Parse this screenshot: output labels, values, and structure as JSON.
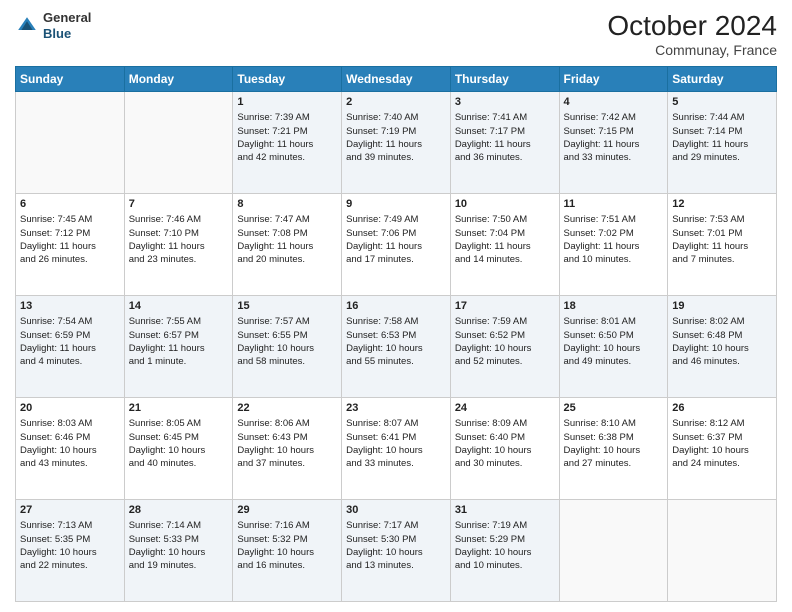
{
  "header": {
    "logo_line1": "General",
    "logo_line2": "Blue",
    "title": "October 2024",
    "subtitle": "Communay, France"
  },
  "days_of_week": [
    "Sunday",
    "Monday",
    "Tuesday",
    "Wednesday",
    "Thursday",
    "Friday",
    "Saturday"
  ],
  "weeks": [
    [
      {
        "day": "",
        "lines": []
      },
      {
        "day": "",
        "lines": []
      },
      {
        "day": "1",
        "lines": [
          "Sunrise: 7:39 AM",
          "Sunset: 7:21 PM",
          "Daylight: 11 hours",
          "and 42 minutes."
        ]
      },
      {
        "day": "2",
        "lines": [
          "Sunrise: 7:40 AM",
          "Sunset: 7:19 PM",
          "Daylight: 11 hours",
          "and 39 minutes."
        ]
      },
      {
        "day": "3",
        "lines": [
          "Sunrise: 7:41 AM",
          "Sunset: 7:17 PM",
          "Daylight: 11 hours",
          "and 36 minutes."
        ]
      },
      {
        "day": "4",
        "lines": [
          "Sunrise: 7:42 AM",
          "Sunset: 7:15 PM",
          "Daylight: 11 hours",
          "and 33 minutes."
        ]
      },
      {
        "day": "5",
        "lines": [
          "Sunrise: 7:44 AM",
          "Sunset: 7:14 PM",
          "Daylight: 11 hours",
          "and 29 minutes."
        ]
      }
    ],
    [
      {
        "day": "6",
        "lines": [
          "Sunrise: 7:45 AM",
          "Sunset: 7:12 PM",
          "Daylight: 11 hours",
          "and 26 minutes."
        ]
      },
      {
        "day": "7",
        "lines": [
          "Sunrise: 7:46 AM",
          "Sunset: 7:10 PM",
          "Daylight: 11 hours",
          "and 23 minutes."
        ]
      },
      {
        "day": "8",
        "lines": [
          "Sunrise: 7:47 AM",
          "Sunset: 7:08 PM",
          "Daylight: 11 hours",
          "and 20 minutes."
        ]
      },
      {
        "day": "9",
        "lines": [
          "Sunrise: 7:49 AM",
          "Sunset: 7:06 PM",
          "Daylight: 11 hours",
          "and 17 minutes."
        ]
      },
      {
        "day": "10",
        "lines": [
          "Sunrise: 7:50 AM",
          "Sunset: 7:04 PM",
          "Daylight: 11 hours",
          "and 14 minutes."
        ]
      },
      {
        "day": "11",
        "lines": [
          "Sunrise: 7:51 AM",
          "Sunset: 7:02 PM",
          "Daylight: 11 hours",
          "and 10 minutes."
        ]
      },
      {
        "day": "12",
        "lines": [
          "Sunrise: 7:53 AM",
          "Sunset: 7:01 PM",
          "Daylight: 11 hours",
          "and 7 minutes."
        ]
      }
    ],
    [
      {
        "day": "13",
        "lines": [
          "Sunrise: 7:54 AM",
          "Sunset: 6:59 PM",
          "Daylight: 11 hours",
          "and 4 minutes."
        ]
      },
      {
        "day": "14",
        "lines": [
          "Sunrise: 7:55 AM",
          "Sunset: 6:57 PM",
          "Daylight: 11 hours",
          "and 1 minute."
        ]
      },
      {
        "day": "15",
        "lines": [
          "Sunrise: 7:57 AM",
          "Sunset: 6:55 PM",
          "Daylight: 10 hours",
          "and 58 minutes."
        ]
      },
      {
        "day": "16",
        "lines": [
          "Sunrise: 7:58 AM",
          "Sunset: 6:53 PM",
          "Daylight: 10 hours",
          "and 55 minutes."
        ]
      },
      {
        "day": "17",
        "lines": [
          "Sunrise: 7:59 AM",
          "Sunset: 6:52 PM",
          "Daylight: 10 hours",
          "and 52 minutes."
        ]
      },
      {
        "day": "18",
        "lines": [
          "Sunrise: 8:01 AM",
          "Sunset: 6:50 PM",
          "Daylight: 10 hours",
          "and 49 minutes."
        ]
      },
      {
        "day": "19",
        "lines": [
          "Sunrise: 8:02 AM",
          "Sunset: 6:48 PM",
          "Daylight: 10 hours",
          "and 46 minutes."
        ]
      }
    ],
    [
      {
        "day": "20",
        "lines": [
          "Sunrise: 8:03 AM",
          "Sunset: 6:46 PM",
          "Daylight: 10 hours",
          "and 43 minutes."
        ]
      },
      {
        "day": "21",
        "lines": [
          "Sunrise: 8:05 AM",
          "Sunset: 6:45 PM",
          "Daylight: 10 hours",
          "and 40 minutes."
        ]
      },
      {
        "day": "22",
        "lines": [
          "Sunrise: 8:06 AM",
          "Sunset: 6:43 PM",
          "Daylight: 10 hours",
          "and 37 minutes."
        ]
      },
      {
        "day": "23",
        "lines": [
          "Sunrise: 8:07 AM",
          "Sunset: 6:41 PM",
          "Daylight: 10 hours",
          "and 33 minutes."
        ]
      },
      {
        "day": "24",
        "lines": [
          "Sunrise: 8:09 AM",
          "Sunset: 6:40 PM",
          "Daylight: 10 hours",
          "and 30 minutes."
        ]
      },
      {
        "day": "25",
        "lines": [
          "Sunrise: 8:10 AM",
          "Sunset: 6:38 PM",
          "Daylight: 10 hours",
          "and 27 minutes."
        ]
      },
      {
        "day": "26",
        "lines": [
          "Sunrise: 8:12 AM",
          "Sunset: 6:37 PM",
          "Daylight: 10 hours",
          "and 24 minutes."
        ]
      }
    ],
    [
      {
        "day": "27",
        "lines": [
          "Sunrise: 7:13 AM",
          "Sunset: 5:35 PM",
          "Daylight: 10 hours",
          "and 22 minutes."
        ]
      },
      {
        "day": "28",
        "lines": [
          "Sunrise: 7:14 AM",
          "Sunset: 5:33 PM",
          "Daylight: 10 hours",
          "and 19 minutes."
        ]
      },
      {
        "day": "29",
        "lines": [
          "Sunrise: 7:16 AM",
          "Sunset: 5:32 PM",
          "Daylight: 10 hours",
          "and 16 minutes."
        ]
      },
      {
        "day": "30",
        "lines": [
          "Sunrise: 7:17 AM",
          "Sunset: 5:30 PM",
          "Daylight: 10 hours",
          "and 13 minutes."
        ]
      },
      {
        "day": "31",
        "lines": [
          "Sunrise: 7:19 AM",
          "Sunset: 5:29 PM",
          "Daylight: 10 hours",
          "and 10 minutes."
        ]
      },
      {
        "day": "",
        "lines": []
      },
      {
        "day": "",
        "lines": []
      }
    ]
  ]
}
